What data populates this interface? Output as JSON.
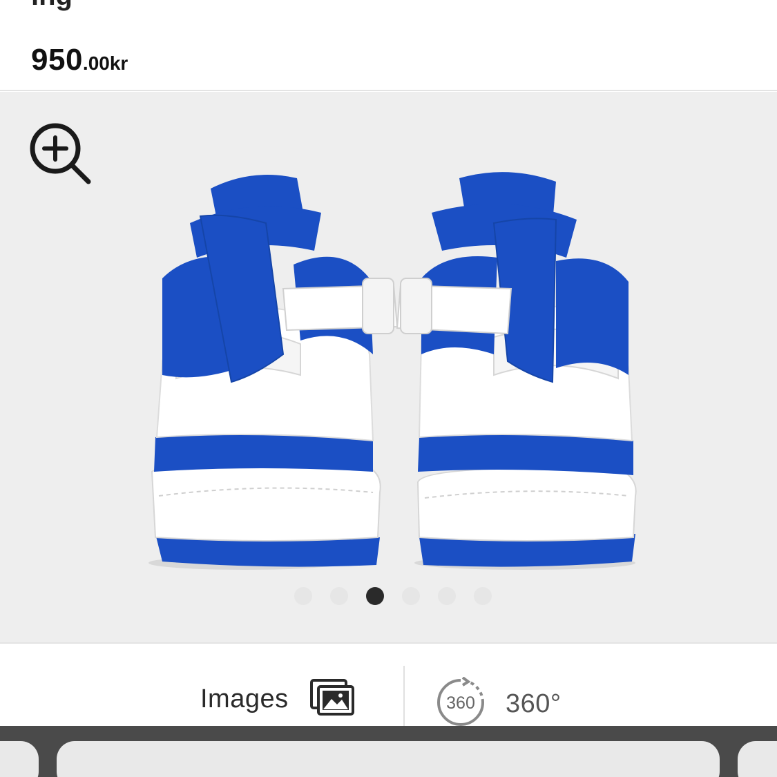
{
  "header": {
    "title_clip": "ing",
    "price_main": "950",
    "price_sub": ".00kr"
  },
  "gallery": {
    "zoom_icon": "zoom-in-icon",
    "image_alt": "blue-white-sneakers-rear-view",
    "dots_count": 6,
    "active_dot": 2
  },
  "view_bar": {
    "images_label": "Images",
    "images_icon": "gallery-icon",
    "spin_label": "360°",
    "spin_badge": "360",
    "spin_icon": "rotate-360-icon"
  },
  "colors": {
    "accent_blue": "#1b4fc4",
    "background": "#eeeeee",
    "text": "#1a1a1a",
    "browser_bar": "#4a4a4a"
  }
}
